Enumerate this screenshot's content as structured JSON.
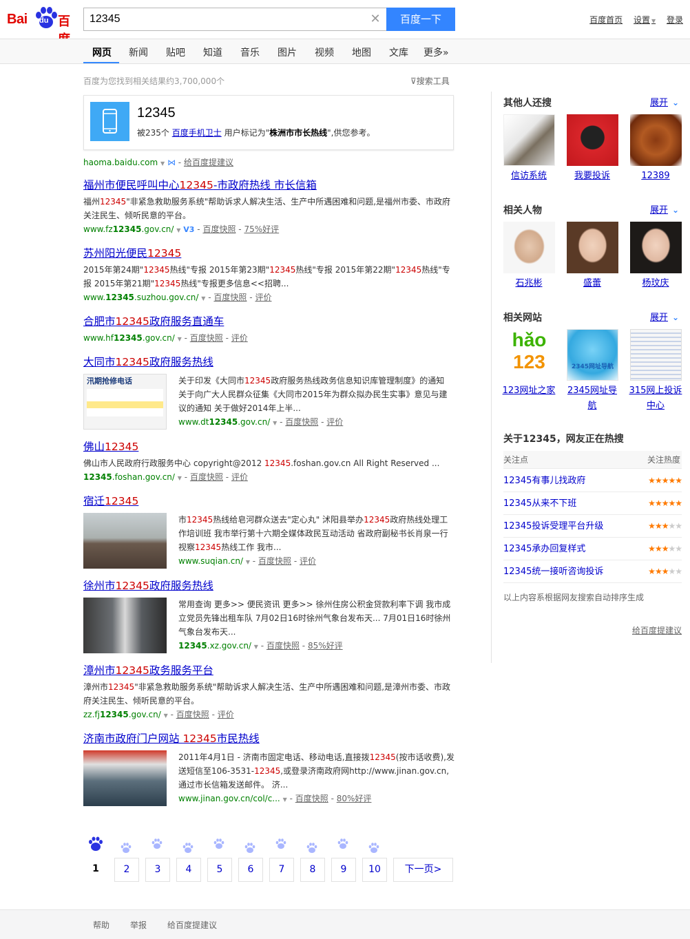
{
  "logo": {
    "text_en": "Bai",
    "text_du": "du",
    "text_cn": "百度"
  },
  "search": {
    "query": "12345",
    "button_label": "百度一下"
  },
  "user_links": {
    "home": "百度首页",
    "settings": "设置",
    "login": "登录"
  },
  "nav": {
    "tabs": [
      "网页",
      "新闻",
      "贴吧",
      "知道",
      "音乐",
      "图片",
      "视频",
      "地图",
      "文库",
      "更多»"
    ],
    "active": "网页"
  },
  "result_count": "百度为您找到相关结果约3,700,000个",
  "search_tools": "搜索工具",
  "phone_card": {
    "number": "12345",
    "desc_prefix": "被235个",
    "desc_link": "百度手机卫士",
    "desc_mid": "用户标记为\"",
    "desc_bold": "株洲市市长热线",
    "desc_suffix": "\",供您参考。",
    "source": "haoma.baidu.com",
    "feedback": "给百度提建议"
  },
  "results": [
    {
      "title_pre": "福州市便民呼叫中心",
      "title_em": "12345",
      "title_post": "-市政府热线 市长信箱",
      "abs_pre": "福州",
      "abs_em": "12345",
      "abs_post": "\"非紧急救助服务系统\"帮助诉求人解决生活、生产中所遇困难和问题,是福州市委、市政府关注民生、倾听民意的平台。",
      "url_pre": "www.fz",
      "url_b": "12345",
      "url_post": ".gov.cn/",
      "v3": "V3",
      "snapshot": "百度快照",
      "extra": "75%好评"
    },
    {
      "title_pre": "苏州阳光便民",
      "title_em": "12345",
      "title_post": "",
      "abs_html": "2015年第24期\"<span class='em'>12345</span>热线\"专报 2015年第23期\"<span class='em'>12345</span>热线\"专报 2015年第22期\"<span class='em'>12345</span>热线\"专报 2015年第21期\"<span class='em'>12345</span>热线\"专报更多信息<<招聘...",
      "url_pre": "www.",
      "url_b": "12345",
      "url_post": ".suzhou.gov.cn/",
      "snapshot": "百度快照",
      "extra": "评价"
    },
    {
      "title_pre": "合肥市",
      "title_em": "12345",
      "title_post": "政府服务直通车",
      "url_pre": "www.hf",
      "url_b": "12345",
      "url_post": ".gov.cn/",
      "snapshot": "百度快照",
      "extra": "评价"
    },
    {
      "title_pre": "大同市",
      "title_em": "12345",
      "title_post": "政府服务热线",
      "abs_html": "关于印发《大同市<span class='em'>12345</span>政府服务热线政务信息知识库管理制度》的通知 关于向广大人民群众征集《大同市2015年为群众拟办民生实事》意见与建议的通知 关于做好2014年上半...",
      "url_pre": "www.dt",
      "url_b": "12345",
      "url_post": ".gov.cn/",
      "snapshot": "百度快照",
      "extra": "评价",
      "thumb_text": "汛期抢修电话"
    },
    {
      "title_pre": "佛山",
      "title_em": "12345",
      "title_post": "",
      "abs_html": "佛山市人民政府行政服务中心 copyright@2012 <span class='em'>12345</span>.foshan.gov.cn All Right Reserved ...",
      "url_pre": "",
      "url_b": "12345",
      "url_post": ".foshan.gov.cn/",
      "snapshot": "百度快照",
      "extra": "评价"
    },
    {
      "title_pre": "宿迁",
      "title_em": "12345",
      "title_post": "",
      "abs_html": "市<span class='em'>12345</span>热线给皂河群众送去\"定心丸\" 沭阳县举办<span class='em'>12345</span>政府热线处理工作培训班 我市举行第十六期全媒体政民互动活动 省政府副秘书长肖泉一行视察<span class='em'>12345</span>热线工作 我市...",
      "url_pre": "www.suqian.cn/",
      "url_b": "",
      "url_post": "",
      "snapshot": "百度快照",
      "extra": "评价"
    },
    {
      "title_pre": "徐州市",
      "title_em": "12345",
      "title_post": "政府服务热线",
      "abs_html": "常用查询 更多>> 便民资讯 更多>> 徐州住房公积金贷款利率下调 我市成立党员先锋出租车队 7月02日16时徐州气象台发布天... 7月01日16时徐州气象台发布天...",
      "url_pre": "",
      "url_b": "12345",
      "url_post": ".xz.gov.cn/",
      "snapshot": "百度快照",
      "extra": "85%好评"
    },
    {
      "title_pre": "漳州市",
      "title_em": "12345",
      "title_post": "政务服务平台",
      "abs_html": "漳州市<span class='em'>12345</span>\"非紧急救助服务系统\"帮助诉求人解决生活、生产中所遇困难和问题,是漳州市委、市政府关注民生、倾听民意的平台。",
      "url_pre": "zz.fj",
      "url_b": "12345",
      "url_post": ".gov.cn/",
      "snapshot": "百度快照",
      "extra": "评价"
    },
    {
      "title_pre": "济南市政府门户网站 ",
      "title_em": "12345",
      "title_post": "市民热线",
      "abs_html": "2011年4月1日 - 济南市固定电话、移动电话,直接拨<span class='em'>12345</span>(按市话收费),发送短信至106-3531-<span class='em'>12345</span>,或登录济南政府网http://www.jinan.gov.cn,通过市长信箱发送邮件。 济...",
      "url_pre": "www.jinan.gov.cn/col/c...",
      "url_b": "",
      "url_post": "",
      "snapshot": "百度快照",
      "extra": "80%好评"
    }
  ],
  "pager": {
    "current": "1",
    "pages": [
      "2",
      "3",
      "4",
      "5",
      "6",
      "7",
      "8",
      "9",
      "10"
    ],
    "next": "下一页>"
  },
  "footer": {
    "help": "帮助",
    "report": "举报",
    "feedback": "给百度提建议"
  },
  "right": {
    "others": {
      "title": "其他人还搜",
      "expand": "展开",
      "items": [
        "信访系统",
        "我要投诉",
        "12389"
      ]
    },
    "people": {
      "title": "相关人物",
      "expand": "展开",
      "items": [
        "石兆彬",
        "盛蕾",
        "杨玟庆"
      ]
    },
    "sites": {
      "title": "相关网站",
      "expand": "展开",
      "items": [
        "123网址之家",
        "2345网址导航",
        "315网上投诉中心"
      ],
      "hao_text": "hǎo",
      "hao_num": "123",
      "site2_text": "2345网址导航"
    },
    "hot": {
      "title": "关于12345，网友正在热搜",
      "col_left": "关注点",
      "col_right": "关注热度",
      "rows": [
        {
          "label": "12345有事儿找政府",
          "stars": 5
        },
        {
          "label": "12345从来不下班",
          "stars": 5
        },
        {
          "label": "12345投诉受理平台升级",
          "stars": 3
        },
        {
          "label": "12345承办回复样式",
          "stars": 3
        },
        {
          "label": "12345统一接听咨询投诉",
          "stars": 3
        }
      ],
      "note": "以上内容系根据网友搜索自动排序生成",
      "feedback": "给百度提建议"
    }
  }
}
